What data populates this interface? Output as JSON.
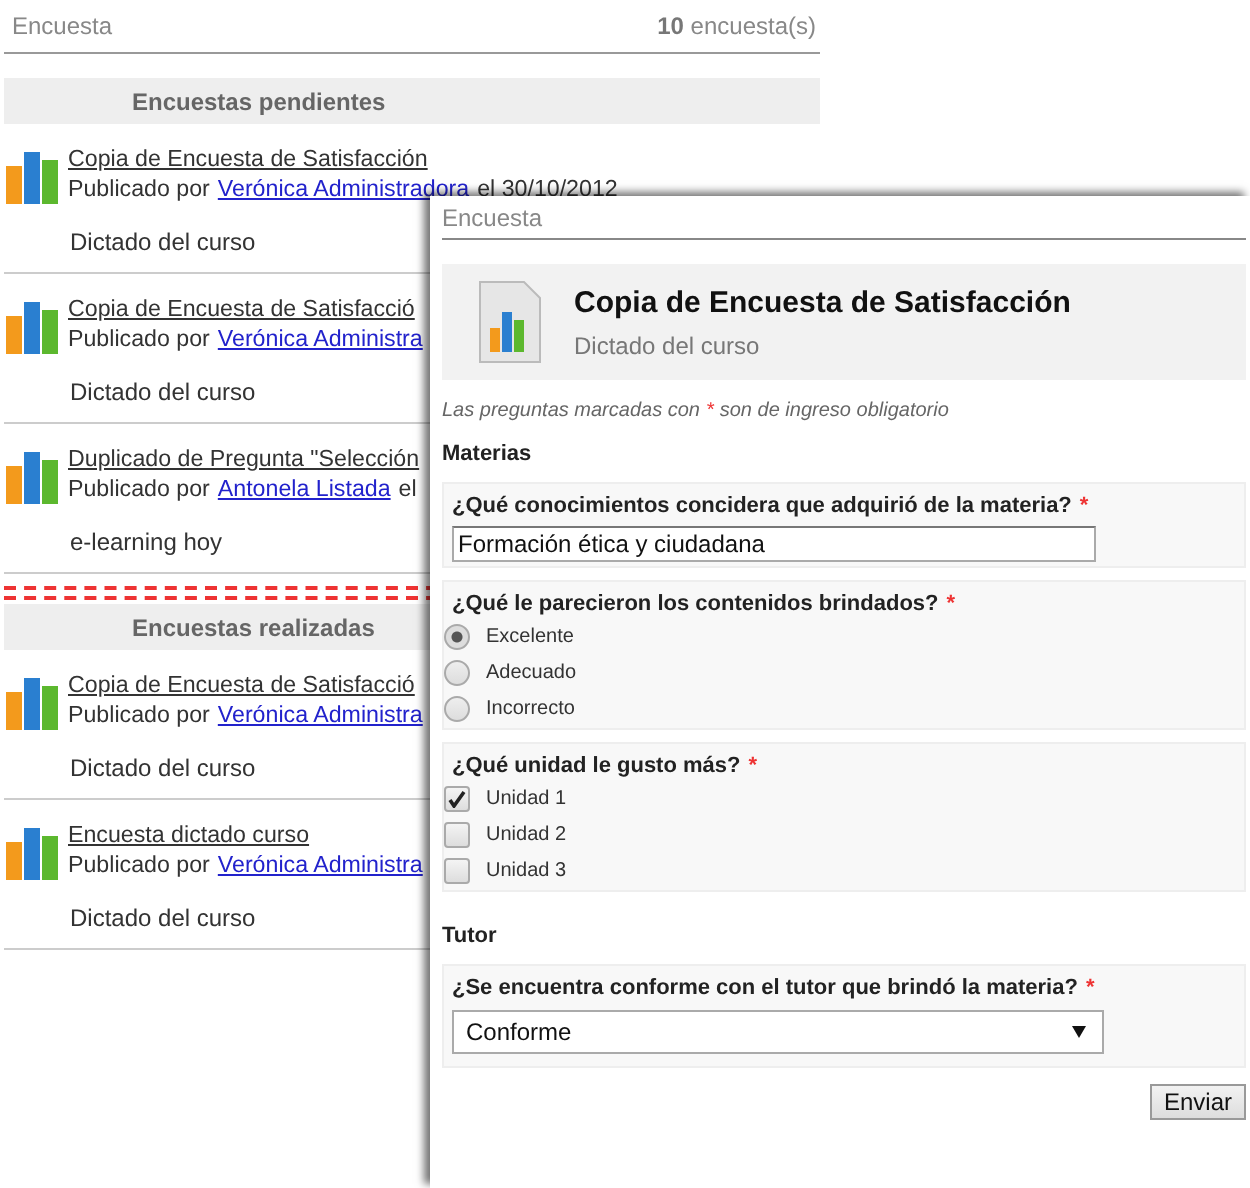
{
  "header": {
    "title": "Encuesta",
    "count": "10",
    "count_label": "encuesta(s)"
  },
  "sections": [
    {
      "title": "Encuestas pendientes",
      "items": [
        {
          "title": "Copia de Encuesta de Satisfacción",
          "by": "Publicado por",
          "author": "Verónica Administradora",
          "suffix": "el 30/10/2012",
          "description": "Dictado del curso"
        },
        {
          "title": "Copia de Encuesta de Satisfacció",
          "by": "Publicado por",
          "author": "Verónica Administra",
          "description": "Dictado del curso"
        },
        {
          "title": "Duplicado de Pregunta \"Selección",
          "by": "Publicado por",
          "author": "Antonela Listada",
          "suffix": "el",
          "description": "e-learning hoy"
        }
      ]
    },
    {
      "title": "Encuestas realizadas",
      "items": [
        {
          "title": "Copia de Encuesta de Satisfacció",
          "by": "Publicado por",
          "author": "Verónica Administra",
          "description": "Dictado del curso"
        },
        {
          "title": "Encuesta dictado curso",
          "by": "Publicado por",
          "author": "Verónica Administra",
          "description": "Dictado del curso"
        }
      ]
    }
  ],
  "dialog": {
    "title": "Encuesta",
    "survey_title": "Copia de Encuesta de Satisfacción",
    "survey_subtitle": "Dictado del curso",
    "note_start": "Las preguntas marcadas con",
    "required_mark": "*",
    "note_end": "son de ingreso obligatorio",
    "groups": [
      {
        "title": "Materias",
        "questions": [
          {
            "kind": "text",
            "text": "¿Qué conocimientos concidera que adquirió de la materia?",
            "required": true,
            "value": "Formación ética y ciudadana"
          },
          {
            "kind": "radio",
            "text": "¿Qué le parecieron los contenidos brindados?",
            "required": true,
            "options": [
              {
                "label": "Excelente",
                "selected": true
              },
              {
                "label": "Adecuado",
                "selected": false
              },
              {
                "label": "Incorrecto",
                "selected": false
              }
            ]
          },
          {
            "kind": "checkbox",
            "text": "¿Qué unidad le gusto más?",
            "required": true,
            "options": [
              {
                "label": "Unidad 1",
                "checked": true
              },
              {
                "label": "Unidad 2",
                "checked": false
              },
              {
                "label": "Unidad 3",
                "checked": false
              }
            ]
          }
        ]
      },
      {
        "title": "Tutor",
        "questions": [
          {
            "kind": "select",
            "text": "¿Se encuentra conforme con el tutor que brindó la materia?",
            "required": true,
            "value": "Conforme"
          }
        ]
      }
    ],
    "submit": "Enviar"
  }
}
